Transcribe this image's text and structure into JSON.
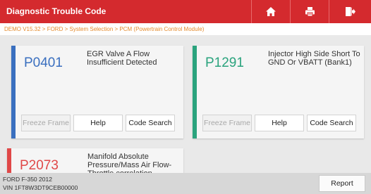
{
  "header": {
    "title": "Diagnostic Trouble Code",
    "accent_color": "#d42a2e",
    "actions": [
      {
        "icon": "home-icon"
      },
      {
        "icon": "print-icon"
      },
      {
        "icon": "exit-icon"
      }
    ]
  },
  "breadcrumb": "DEMO V15.32 > FORD > System Selection > PCM (Powertrain Control Module)",
  "dtcs": [
    {
      "code": "P0401",
      "description": "EGR Valve A Flow Insufficient Detected",
      "color": "#3a6fbf",
      "buttons": {
        "freeze_frame": "Freeze Frame",
        "help": "Help",
        "code_search": "Code Search"
      }
    },
    {
      "code": "P1291",
      "description": "Injector High Side Short To GND Or VBATT (Bank1)",
      "color": "#2aa37d",
      "buttons": {
        "freeze_frame": "Freeze Frame",
        "help": "Help",
        "code_search": "Code Search"
      }
    },
    {
      "code": "P2073",
      "description": "Manifold Absolute Pressure/Mass Air Flow-Throttle correlation",
      "color": "#e04848"
    }
  ],
  "footer": {
    "vehicle": "FORD F-350 2012",
    "vin": "VIN 1FT8W3DT9CEB00000",
    "report_label": "Report"
  }
}
